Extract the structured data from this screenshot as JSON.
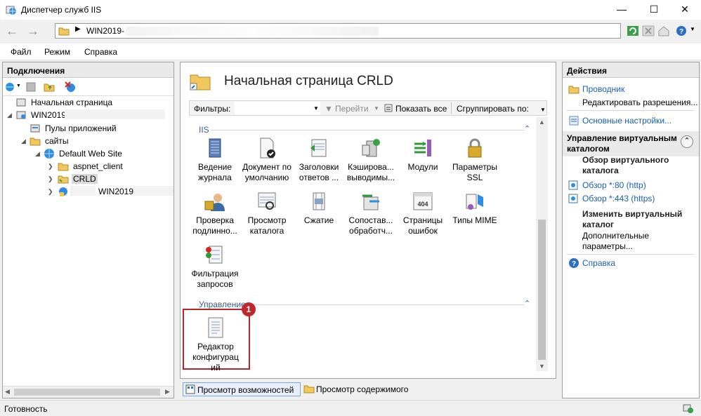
{
  "window": {
    "title": "Диспетчер служб IIS"
  },
  "address": {
    "path_segment": "WIN2019-"
  },
  "menu": [
    "Файл",
    "Режим",
    "Справка"
  ],
  "connections": {
    "header": "Подключения",
    "tree": {
      "start_page": "Начальная страница",
      "server": "WIN2019",
      "app_pools": "Пулы приложений",
      "sites": "сайты",
      "default_site": "Default Web Site",
      "aspnet": "aspnet_client",
      "crld": "CRLD",
      "win2019": "WIN2019"
    }
  },
  "center": {
    "title": "Начальная страница CRLD",
    "filter_label": "Фильтры:",
    "go": "Перейти",
    "show_all": "Показать все",
    "group_by": "Сгруппировать по:",
    "section_iis": "IIS",
    "section_manage": "Управление",
    "features_iis": [
      {
        "l1": "Ведение",
        "l2": "журнала",
        "icon": "logging-icon"
      },
      {
        "l1": "Документ по",
        "l2": "умолчанию",
        "icon": "default-document-icon"
      },
      {
        "l1": "Заголовки",
        "l2": "ответов ...",
        "icon": "response-headers-icon"
      },
      {
        "l1": "Кэширова...",
        "l2": "выводимы...",
        "icon": "output-caching-icon"
      },
      {
        "l1": "Модули",
        "l2": "",
        "icon": "modules-icon"
      },
      {
        "l1": "Параметры",
        "l2": "SSL",
        "icon": "ssl-icon"
      },
      {
        "l1": "Проверка",
        "l2": "подлинно...",
        "icon": "authentication-icon"
      },
      {
        "l1": "Просмотр",
        "l2": "каталога",
        "icon": "directory-browsing-icon"
      },
      {
        "l1": "Сжатие",
        "l2": "",
        "icon": "compression-icon"
      },
      {
        "l1": "Сопостав...",
        "l2": "обработч...",
        "icon": "handler-mappings-icon"
      },
      {
        "l1": "Страницы",
        "l2": "ошибок",
        "icon": "error-pages-icon"
      },
      {
        "l1": "Типы MIME",
        "l2": "",
        "icon": "mime-types-icon"
      },
      {
        "l1": "Фильтрация",
        "l2": "запросов",
        "icon": "request-filtering-icon"
      }
    ],
    "feature_manage": {
      "l1": "Редактор",
      "l2": "конфигурац",
      "l3": "ий"
    },
    "badge": "1",
    "error_page_code": "404"
  },
  "view_tabs": {
    "features": "Просмотр возможностей",
    "content": "Просмотр содержимого"
  },
  "actions": {
    "header": "Действия",
    "explore": "Проводник",
    "edit_perms": "Редактировать разрешения...",
    "basic_settings": "Основные настройки...",
    "group_title": "Управление виртуальным каталогом",
    "browse_title": "Обзор виртуального каталога",
    "browse80": "Обзор *:80 (http)",
    "browse443": "Обзор *:443 (https)",
    "edit_title": "Изменить виртуальный каталог",
    "advanced": "Дополнительные параметры...",
    "help": "Справка"
  },
  "status": {
    "text": "Готовность"
  },
  "colors": {
    "accent_link": "#1a5fb4",
    "badge_red": "#c0262d",
    "highlight_border": "#b5262b"
  }
}
